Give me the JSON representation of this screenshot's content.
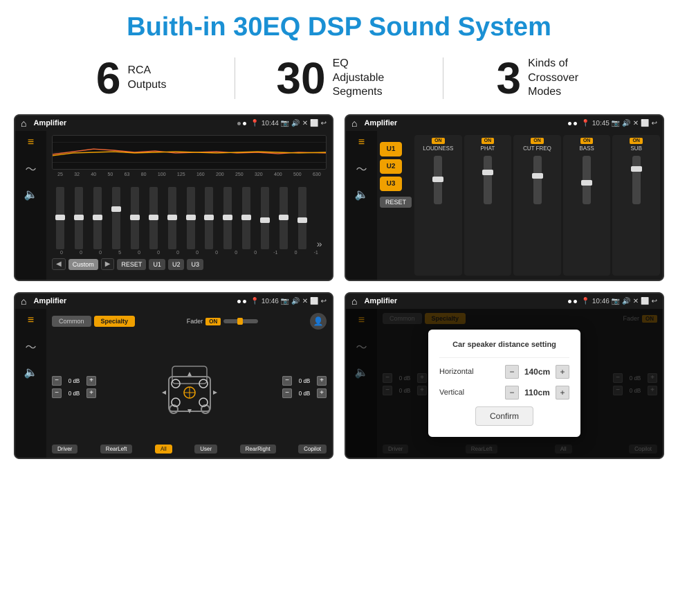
{
  "page": {
    "title": "Buith-in 30EQ DSP Sound System"
  },
  "stats": [
    {
      "number": "6",
      "label": "RCA\nOutputs"
    },
    {
      "number": "30",
      "label": "EQ Adjustable\nSegments"
    },
    {
      "number": "3",
      "label": "Kinds of\nCrossover Modes"
    }
  ],
  "screens": [
    {
      "id": "screen1",
      "status_bar": {
        "app": "Amplifier",
        "time": "10:44"
      },
      "type": "eq"
    },
    {
      "id": "screen2",
      "status_bar": {
        "app": "Amplifier",
        "time": "10:45"
      },
      "type": "channels"
    },
    {
      "id": "screen3",
      "status_bar": {
        "app": "Amplifier",
        "time": "10:46"
      },
      "type": "speaker"
    },
    {
      "id": "screen4",
      "status_bar": {
        "app": "Amplifier",
        "time": "10:46"
      },
      "type": "speaker-dialog"
    }
  ],
  "eq": {
    "frequencies": [
      "25",
      "32",
      "40",
      "50",
      "63",
      "80",
      "100",
      "125",
      "160",
      "200",
      "250",
      "320",
      "400",
      "500",
      "630"
    ],
    "values": [
      "0",
      "0",
      "0",
      "5",
      "0",
      "0",
      "0",
      "0",
      "0",
      "0",
      "0",
      "-1",
      "0",
      "-1"
    ],
    "preset": "Custom",
    "buttons": [
      "RESET",
      "U1",
      "U2",
      "U3"
    ]
  },
  "channels": {
    "u_buttons": [
      "U1",
      "U2",
      "U3"
    ],
    "cols": [
      "LOUDNESS",
      "PHAT",
      "CUT FREQ",
      "BASS",
      "SUB"
    ],
    "all_on": true,
    "reset_label": "RESET"
  },
  "speaker": {
    "tabs": [
      "Common",
      "Specialty"
    ],
    "active_tab": "Specialty",
    "fader_label": "Fader",
    "fader_on": true,
    "db_values": [
      "0 dB",
      "0 dB",
      "0 dB",
      "0 dB"
    ],
    "footer_buttons": [
      "Driver",
      "RearLeft",
      "All",
      "User",
      "RearRight",
      "Copilot"
    ]
  },
  "dialog": {
    "title": "Car speaker distance setting",
    "horizontal_label": "Horizontal",
    "horizontal_value": "140cm",
    "vertical_label": "Vertical",
    "vertical_value": "110cm",
    "confirm_label": "Confirm"
  }
}
